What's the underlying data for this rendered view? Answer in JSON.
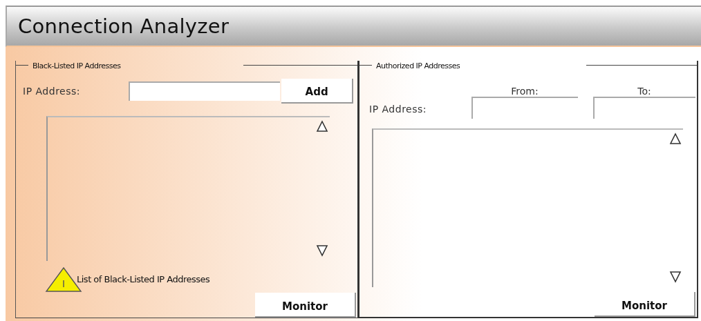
{
  "window": {
    "title": "Connection Analyzer"
  },
  "blacklist": {
    "title": "Black-Listed IP Addresses",
    "ip_label": "IP Address:",
    "add_button": "Add",
    "caption": "List of Black-Listed IP Addresses",
    "monitor_button": "Monitor"
  },
  "authorized": {
    "title": "Authorized IP Addresses",
    "ip_label": "IP Address:",
    "from_label": "From:",
    "to_label": "To:",
    "monitor_button": "Monitor"
  }
}
